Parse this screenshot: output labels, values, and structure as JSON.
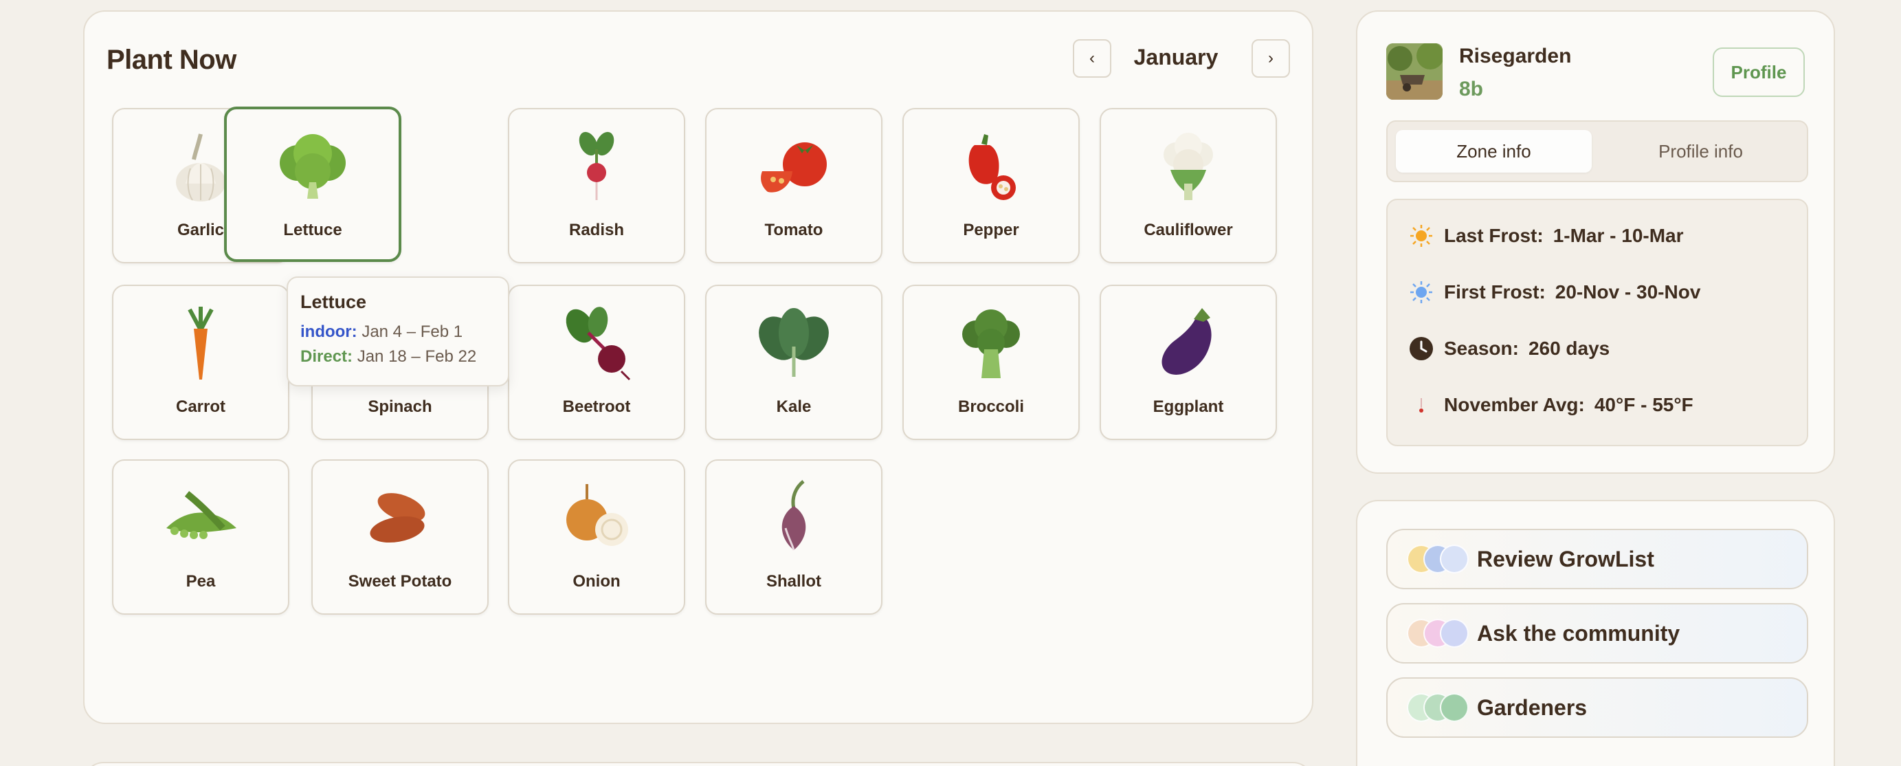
{
  "plant_now": {
    "title": "Plant Now",
    "month": "January",
    "prev_label": "‹",
    "next_label": "›",
    "plants": [
      {
        "name": "Garlic",
        "icon": "garlic-icon"
      },
      {
        "name": "Lettuce",
        "icon": "lettuce-icon",
        "selected": true
      },
      {
        "name": "Radish",
        "icon": "radish-icon"
      },
      {
        "name": "Tomato",
        "icon": "tomato-icon"
      },
      {
        "name": "Pepper",
        "icon": "pepper-icon"
      },
      {
        "name": "Cauliflower",
        "icon": "cauliflower-icon"
      },
      {
        "name": "Carrot",
        "icon": "carrot-icon"
      },
      {
        "name": "Spinach",
        "icon": "spinach-icon"
      },
      {
        "name": "Beetroot",
        "icon": "beetroot-icon"
      },
      {
        "name": "Kale",
        "icon": "kale-icon"
      },
      {
        "name": "Broccoli",
        "icon": "broccoli-icon"
      },
      {
        "name": "Eggplant",
        "icon": "eggplant-icon"
      },
      {
        "name": "Pea",
        "icon": "pea-icon"
      },
      {
        "name": "Sweet Potato",
        "icon": "sweet-potato-icon"
      },
      {
        "name": "Onion",
        "icon": "onion-icon"
      },
      {
        "name": "Shallot",
        "icon": "shallot-icon"
      }
    ],
    "tooltip": {
      "title": "Lettuce",
      "indoor_label": "indoor:",
      "indoor_value": "Jan 4 – Feb 1",
      "direct_label": "Direct:",
      "direct_value": "Jan 18 – Feb 22"
    }
  },
  "profile": {
    "name": "Risegarden",
    "zone": "8b",
    "profile_button": "Profile",
    "tabs": {
      "zone": "Zone info",
      "profile": "Profile info"
    },
    "zone_info": {
      "last_frost_label": "Last Frost:",
      "last_frost_value": "1-Mar - 10-Mar",
      "first_frost_label": "First Frost:",
      "first_frost_value": "20-Nov - 30-Nov",
      "season_label": "Season:",
      "season_value": "260 days",
      "avg_label": "November Avg:",
      "avg_value": "40°F - 55°F"
    }
  },
  "actions": [
    {
      "label": "Review GrowList",
      "colors": [
        "#f6dc95",
        "#b7c9ee",
        "#d9e2f7"
      ]
    },
    {
      "label": "Ask the community",
      "colors": [
        "#f5dcc6",
        "#f3c9e7",
        "#cfd6f5"
      ]
    },
    {
      "label": "Gardeners",
      "colors": [
        "#d3ecd5",
        "#b9ddbf",
        "#9fcfa9"
      ]
    }
  ],
  "colors": {
    "accent_green": "#5b8a4b",
    "indoor_blue": "#3555c9"
  }
}
